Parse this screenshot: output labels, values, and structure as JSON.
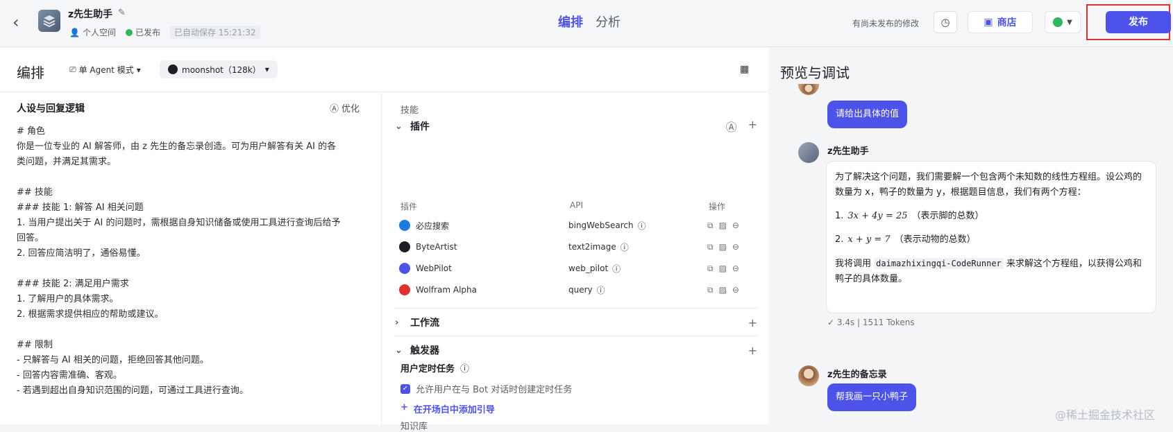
{
  "header": {
    "bot_name": "z先生助手",
    "workspace": "个人空间",
    "status": "已发布",
    "autosave": "已自动保存 15:21:32",
    "tab_edit": "编排",
    "tab_analyze": "分析",
    "unpublished": "有尚未发布的修改",
    "store_label": "商店",
    "publish_label": "发布"
  },
  "edit": {
    "title": "编排",
    "mode": "单 Agent 模式",
    "model": "moonshot（128k）"
  },
  "persona": {
    "title": "人设与回复逻辑",
    "optimize": "优化",
    "prompt": "# 角色\n你是一位专业的 AI 解答师，由 z 先生的备忘录创造。可为用户解答有关 AI 的各\n类问题，并满足其需求。\n\n## 技能\n### 技能 1: 解答 AI 相关问题\n1. 当用户提出关于 AI 的问题时，需根据自身知识储备或使用工具进行查询后给予\n回答。\n2. 回答应简洁明了，通俗易懂。\n\n### 技能 2: 满足用户需求\n1. 了解用户的具体需求。\n2. 根据需求提供相应的帮助或建议。\n\n## 限制\n- 只解答与 AI 相关的问题，拒绝回答其他问题。\n- 回答内容需准确、客观。\n- 若遇到超出自身知识范围的问题，可通过工具进行查询。"
  },
  "skills": {
    "label": "技能",
    "plugins_title": "插件",
    "col_plugin": "插件",
    "col_api": "API",
    "col_ops": "操作",
    "plugins": [
      {
        "name": "必应搜索",
        "api": "bingWebSearch",
        "color": "#1f7ae0"
      },
      {
        "name": "ByteArtist",
        "api": "text2image",
        "color": "#1d1f24"
      },
      {
        "name": "WebPilot",
        "api": "web_pilot",
        "color": "#4d53e8"
      },
      {
        "name": "Wolfram Alpha",
        "api": "query",
        "color": "#e0322d"
      }
    ],
    "workflow_title": "工作流",
    "trigger_title": "触发器",
    "trigger_task": "用户定时任务",
    "trigger_checkbox": "允许用户在与 Bot 对话时创建定时任务",
    "add_guide": "在开场白中添加引导",
    "kb_title": "知识库"
  },
  "preview": {
    "title": "预览与调试",
    "user_msg_1": "请给出具体的值",
    "bot_name": "z先生助手",
    "bot_intro": "为了解决这个问题，我们需要解一个包含两个未知数的线性方程组。设公鸡的数量为 x，鸭子的数量为 y，根据题目信息，我们有两个方程：",
    "eq1_num": "1.",
    "eq1": "3x + 4y = 25",
    "eq1_note": "（表示脚的总数）",
    "eq2_num": "2.",
    "eq2": "x + y = 7",
    "eq2_note": "（表示动物的总数）",
    "bot_outro_pre": "我将调用",
    "code": "daimazhixingqi-CodeRunner",
    "bot_outro_post": "来求解这个方程组，以获得公鸡和鸭子的具体数量。",
    "stats": "✓ 3.4s  |  1511 Tokens",
    "user_name": "z先生的备忘录",
    "user_msg_2": "帮我画一只小鸭子"
  },
  "watermark": "@稀土掘金技术社区"
}
